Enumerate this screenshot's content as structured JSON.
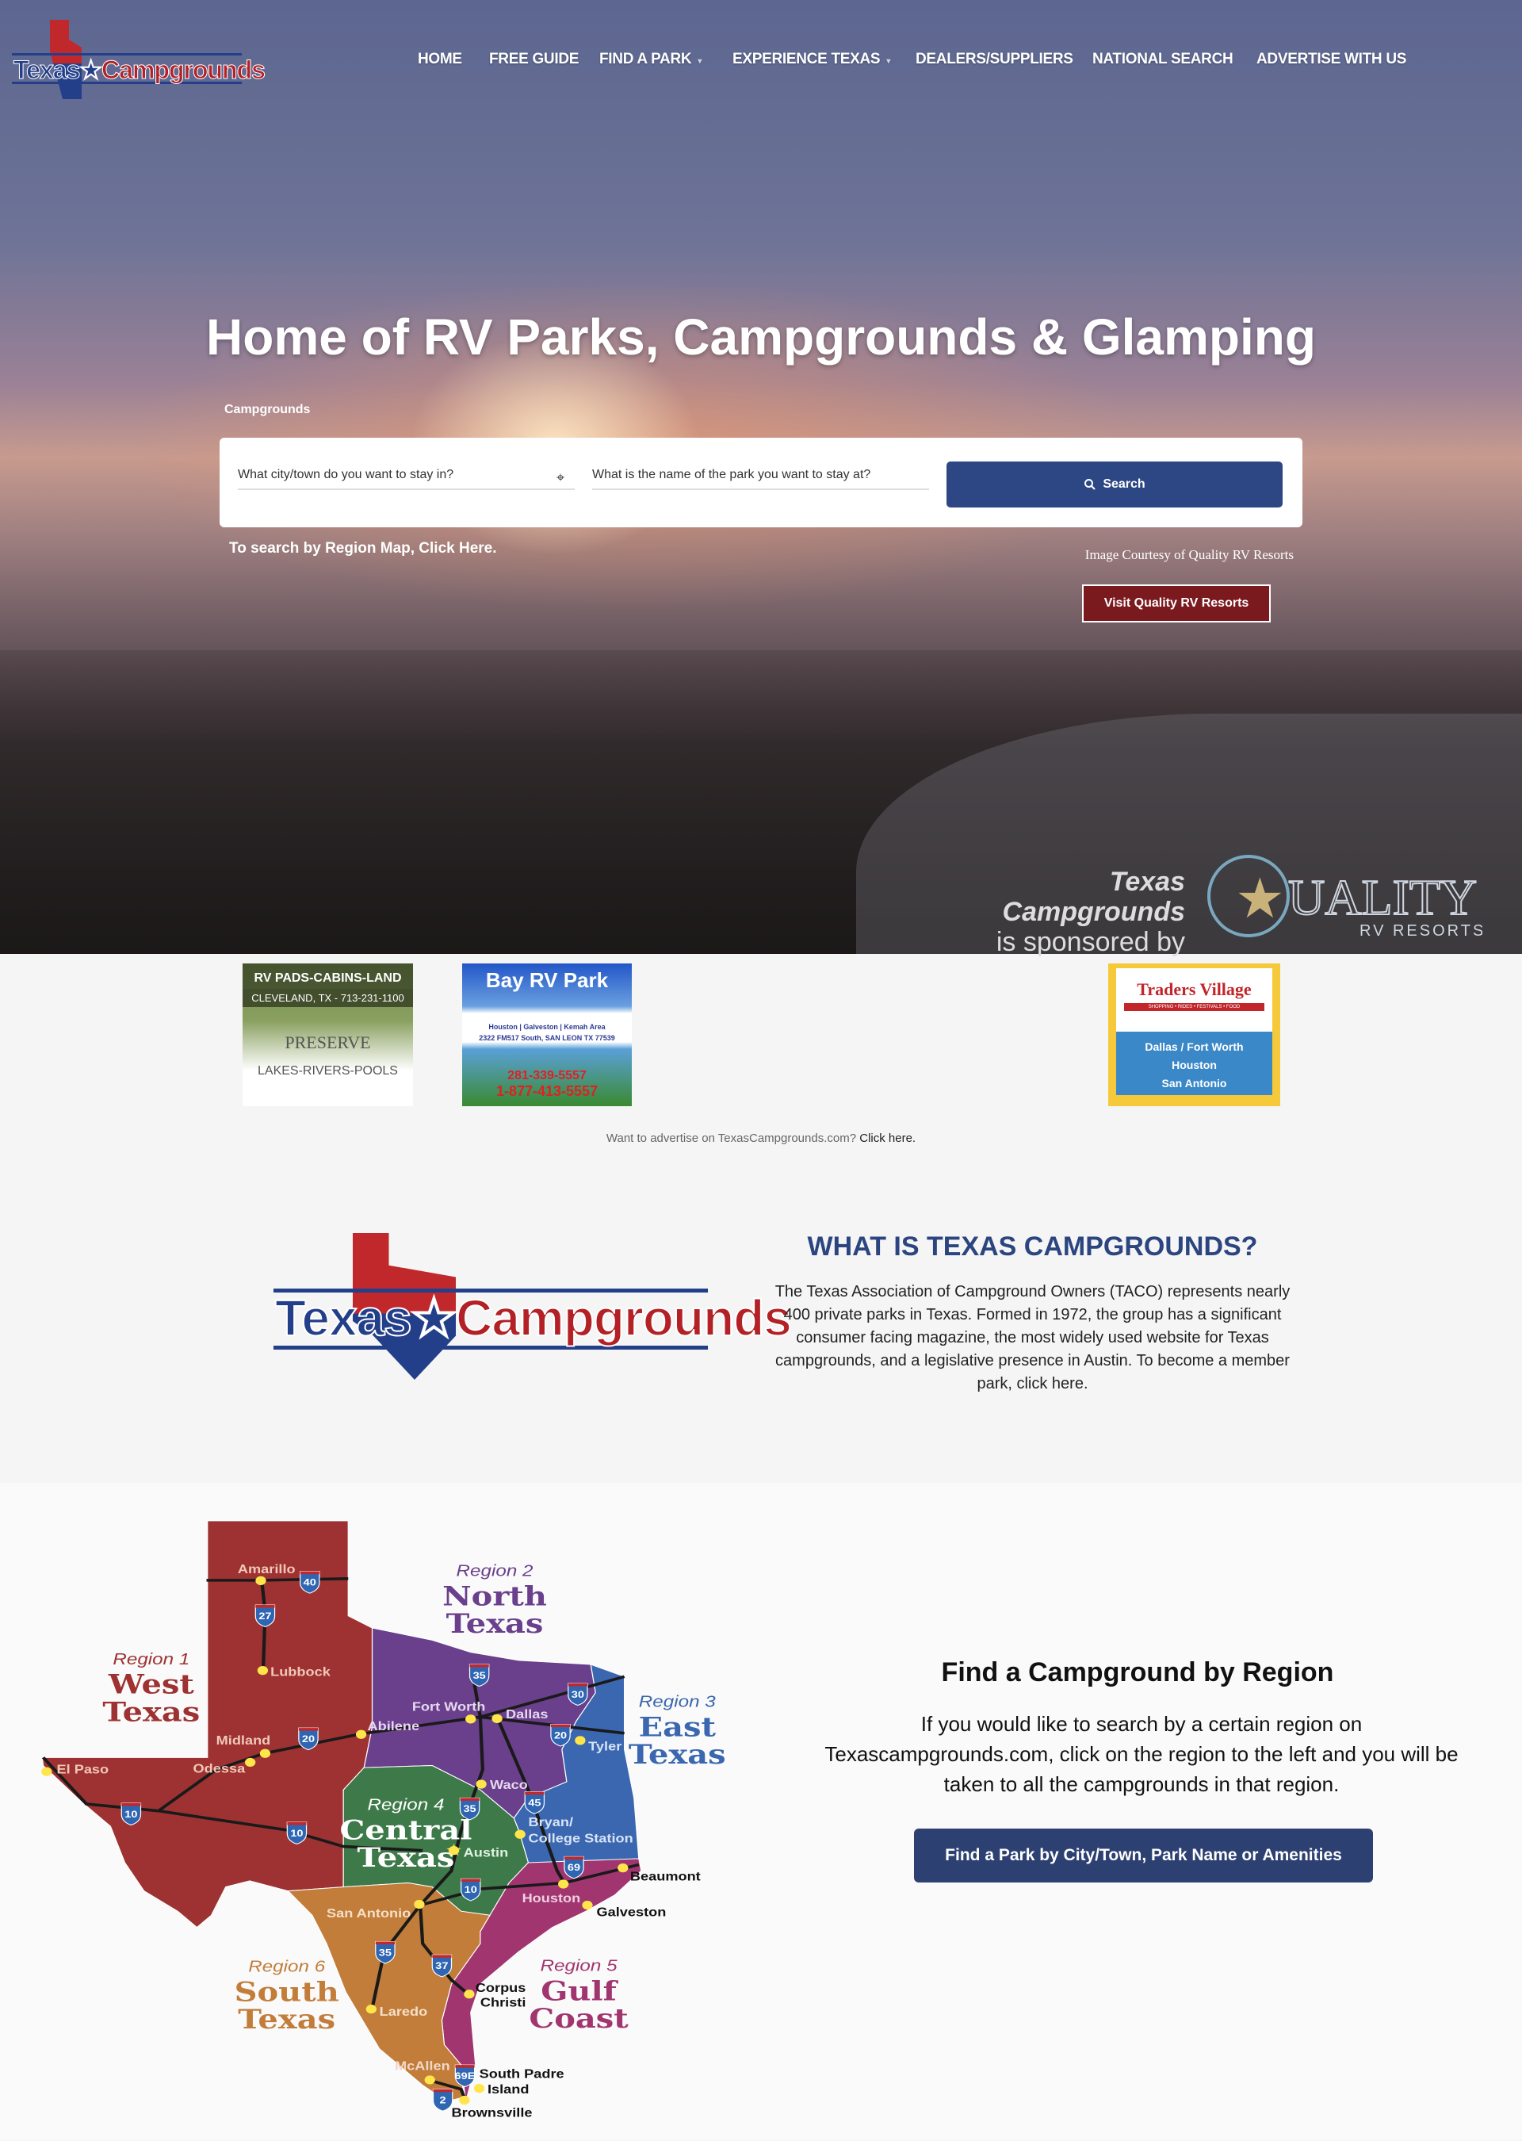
{
  "header": {
    "logo_text": [
      "Texas",
      "Campgrounds"
    ],
    "nav": [
      {
        "label": "HOME"
      },
      {
        "label": "FREE GUIDE"
      },
      {
        "label": "FIND A PARK",
        "dropdown": true
      },
      {
        "label": "EXPERIENCE TEXAS",
        "dropdown": true
      },
      {
        "label": "DEALERS/SUPPLIERS"
      },
      {
        "label": "NATIONAL SEARCH"
      },
      {
        "label": "ADVERTISE WITH US"
      }
    ]
  },
  "hero": {
    "title": "Home of RV Parks, Campgrounds & Glamping",
    "tab_label": "Campgrounds",
    "city_placeholder": "What city/town do you want to stay in?",
    "park_placeholder": "What is the name of the park you want to stay at?",
    "search_label": "Search",
    "region_link": "To search by Region Map, Click Here.",
    "courtesy": "Image Courtesy of Quality RV Resorts",
    "visit_label": "Visit Quality RV Resorts",
    "sponsor_line1": "Texas Campgrounds",
    "sponsor_line2": "is sponsored by",
    "sponsor_logo": [
      "QUALITY",
      "RV RESORTS"
    ]
  },
  "ads": {
    "ad1": {
      "title": "RV PADS-CABINS-LAND",
      "sub": "CLEVELAND, TX - 713-231-1100",
      "brand": "PRESERVE",
      "foot": "LAKES-RIVERS-POOLS"
    },
    "ad2": {
      "title": "Bay RV Park",
      "area": "Houston | Galveston | Kemah Area",
      "address": "2322 FM517 South, SAN LEON TX 77539",
      "phone1": "281-339-5557",
      "phone2": "1-877-413-5557"
    },
    "ad3": {
      "title": "Traders Village",
      "tag": "SHOPPING • RIDES • FESTIVALS • FOOD",
      "cities": [
        "Dallas / Fort Worth",
        "Houston",
        "San Antonio"
      ]
    },
    "advertise_text": "Want to advertise on TexasCampgrounds.com?",
    "advertise_link": "Click here."
  },
  "about": {
    "heading": "WHAT IS TEXAS CAMPGROUNDS?",
    "body": "The Texas Association of Campground Owners (TACO) represents nearly 400 private parks in Texas. Formed in 1972, the group has a significant consumer facing magazine, the most widely used website for Texas campgrounds, and a legislative presence in Austin. To become a member park, click here."
  },
  "region": {
    "heading": "Find a Campground by Region",
    "body": "If you would like to search by a certain region on Texascampgrounds.com, click on the region to the left and you will be taken to all the campgrounds in that region.",
    "button": "Find a Park by City/Town, Park Name or Amenities"
  },
  "map": {
    "regions": [
      {
        "num": "Region 1",
        "name1": "West",
        "name2": "Texas",
        "color": "#9e3232"
      },
      {
        "num": "Region 2",
        "name1": "North",
        "name2": "Texas",
        "color": "#6a3f8c"
      },
      {
        "num": "Region 3",
        "name1": "East",
        "name2": "Texas",
        "color": "#3a67b0"
      },
      {
        "num": "Region 4",
        "name1": "Central",
        "name2": "Texas",
        "color": "#3e7a49"
      },
      {
        "num": "Region 5",
        "name1": "Gulf",
        "name2": "Coast",
        "color": "#a13570"
      },
      {
        "num": "Region 6",
        "name1": "South",
        "name2": "Texas",
        "color": "#c27d3a"
      }
    ],
    "cities": [
      "Amarillo",
      "Lubbock",
      "Midland",
      "Odessa",
      "El Paso",
      "Abilene",
      "Fort Worth",
      "Dallas",
      "Tyler",
      "Waco",
      "Bryan/",
      "College Station",
      "Austin",
      "San Antonio",
      "Houston",
      "Beaumont",
      "Galveston",
      "Corpus",
      "Christi",
      "Laredo",
      "McAllen",
      "South Padre",
      "Island",
      "Brownsville"
    ],
    "highways": [
      "40",
      "27",
      "35",
      "30",
      "20",
      "20",
      "10",
      "10",
      "35",
      "45",
      "69",
      "10",
      "35",
      "37",
      "69E",
      "2"
    ]
  }
}
